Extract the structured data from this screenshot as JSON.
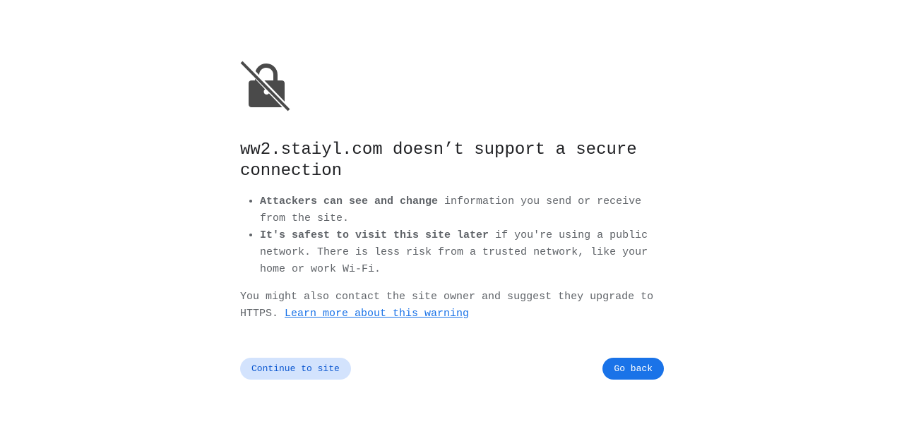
{
  "icon": "lock-slash-icon",
  "heading": "ww2.staiyl.com doesn’t support a secure connection",
  "bullets": [
    {
      "bold": "Attackers can see and change",
      "text": " information you send or receive from the site."
    },
    {
      "bold": "It's safest to visit this site later",
      "text": " if you're using a public network. There is less risk from a trusted network, like your home or work Wi-Fi."
    }
  ],
  "extra_text": "You might also contact the site owner and suggest they upgrade to HTTPS. ",
  "learn_more_link": "Learn more about this warning",
  "buttons": {
    "continue_label": "Continue to site",
    "back_label": "Go back"
  },
  "colors": {
    "primary": "#1a73e8",
    "tonal": "#d3e3fd",
    "icon": "#4a4a4a"
  }
}
